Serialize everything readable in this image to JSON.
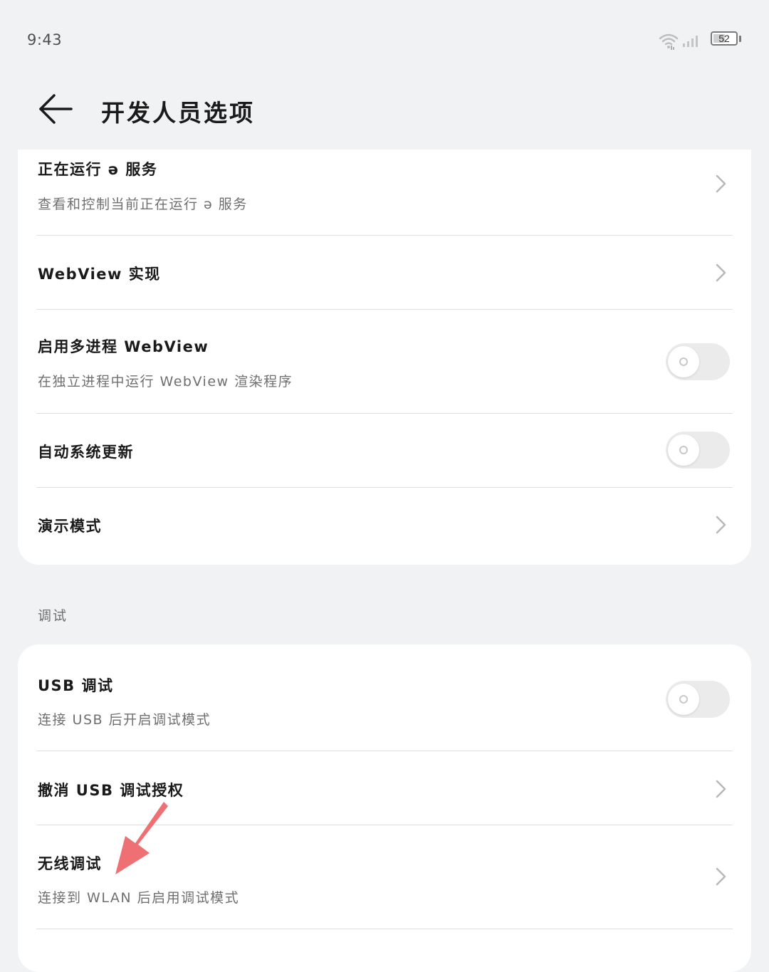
{
  "status_bar": {
    "time": "9:43",
    "battery": "52",
    "icons": [
      "wifi-icon",
      "signal-icon",
      "battery-icon"
    ]
  },
  "header": {
    "title": "开发人员选项",
    "back_icon": "arrow-left-icon"
  },
  "top_section": {
    "items": [
      {
        "title": "正在运行 ə 服务",
        "subtitle": "查看和控制当前正在运行 ə 服务",
        "control": "chevron"
      },
      {
        "title": "WebView 实现",
        "control": "chevron"
      },
      {
        "title": "启用多进程 WebView",
        "subtitle": "在独立进程中运行 WebView 渲染程序",
        "control": "toggle",
        "enabled": false
      },
      {
        "title": "自动系统更新",
        "control": "toggle",
        "enabled": false
      },
      {
        "title": "演示模式",
        "control": "chevron"
      }
    ]
  },
  "debug_section": {
    "label": "调试",
    "items": [
      {
        "title": "USB 调试",
        "subtitle": "连接 USB 后开启调试模式",
        "control": "toggle",
        "enabled": false
      },
      {
        "title": "撤消 USB 调试授权",
        "control": "chevron"
      },
      {
        "title": "无线调试",
        "subtitle": "连接到 WLAN 后启用调试模式",
        "control": "chevron"
      }
    ]
  },
  "colors": {
    "background": "#f1f2f4",
    "card": "#ffffff",
    "toggle_off": "#ebebeb",
    "annotation_arrow": "#ee6f74"
  }
}
